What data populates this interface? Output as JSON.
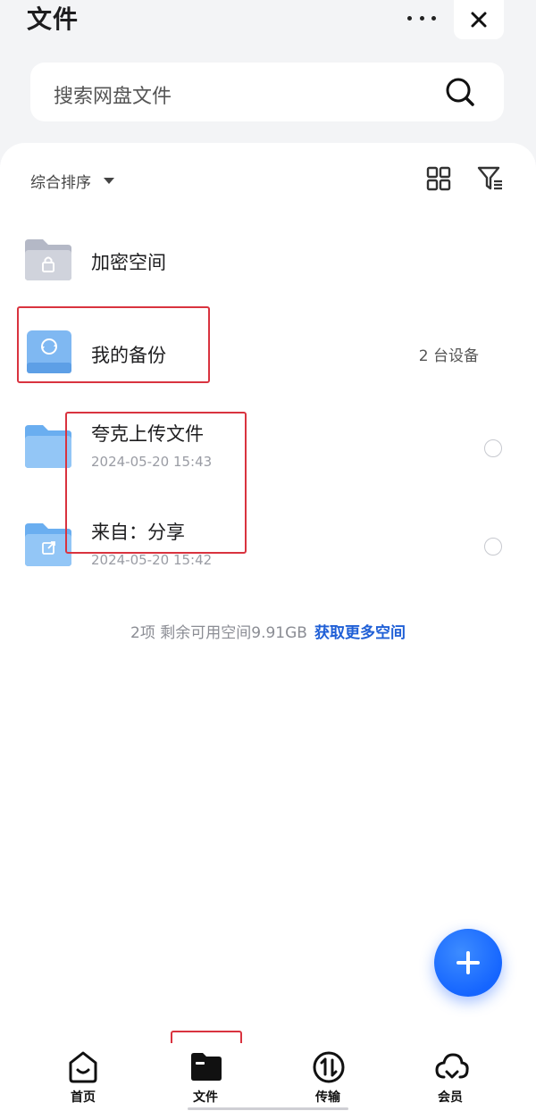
{
  "header": {
    "title": "文件"
  },
  "search": {
    "placeholder": "搜索网盘文件"
  },
  "toolbar": {
    "sort_label": "综合排序"
  },
  "files": [
    {
      "name": "加密空间",
      "date": "",
      "extra": ""
    },
    {
      "name": "我的备份",
      "date": "",
      "extra": "2 台设备"
    },
    {
      "name": "夸克上传文件",
      "date": "2024-05-20 15:43",
      "extra": ""
    },
    {
      "name": "来自：分享",
      "date": "2024-05-20 15:42",
      "extra": ""
    }
  ],
  "footer": {
    "summary": "2项 剩余可用空间9.91GB",
    "link": "获取更多空间"
  },
  "tabs": [
    {
      "label": "首页"
    },
    {
      "label": "文件"
    },
    {
      "label": "传输"
    },
    {
      "label": "会员"
    }
  ],
  "colors": {
    "accent": "#1f5fd6",
    "fab": "#1565ff",
    "highlight": "#d9333f",
    "folder": "#8fc3f5",
    "locked_folder": "#c9ccd6"
  }
}
